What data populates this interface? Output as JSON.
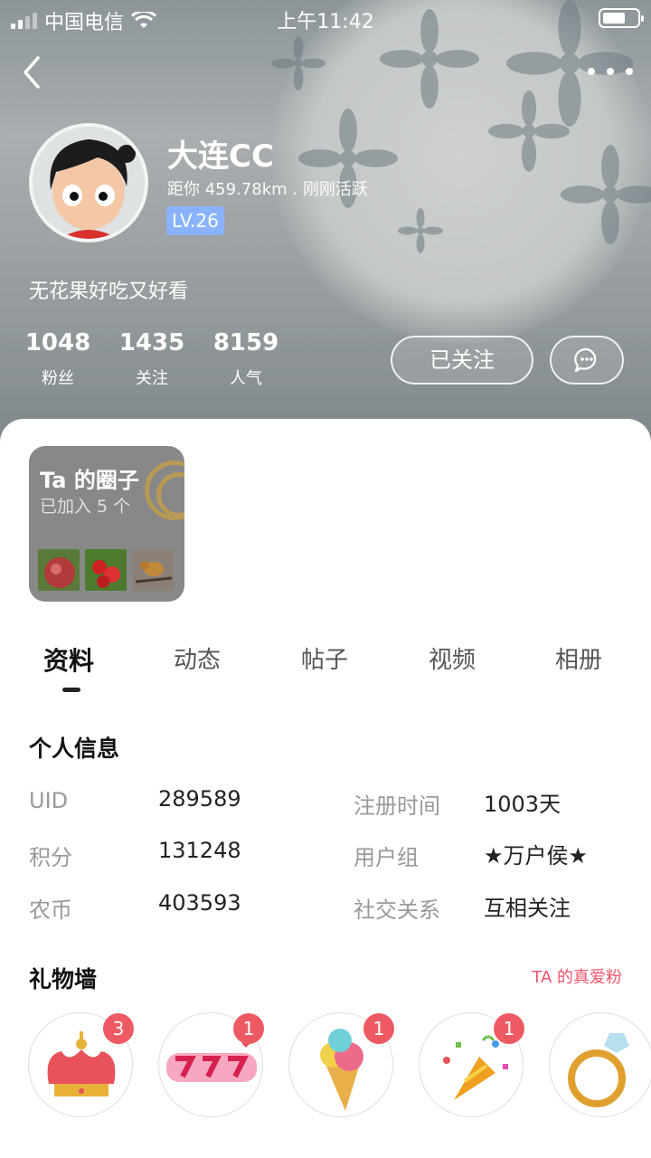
{
  "status_bar": {
    "carrier": "中国电信",
    "time": "上午11:42"
  },
  "profile": {
    "nickname": "大连CC",
    "distance_text": "距你 459.78km . 刚刚活跃",
    "level": "LV.26",
    "bio": "无花果好吃又好看"
  },
  "stats": [
    {
      "value": "1048",
      "label": "粉丝"
    },
    {
      "value": "1435",
      "label": "关注"
    },
    {
      "value": "8159",
      "label": "人气"
    }
  ],
  "actions": {
    "follow_label": "已关注"
  },
  "circles": {
    "title": "Ta 的圈子",
    "subtitle": "已加入 5 个"
  },
  "tabs": [
    "资料",
    "动态",
    "帖子",
    "视频",
    "相册"
  ],
  "active_tab": "资料",
  "personal_info": {
    "title": "个人信息",
    "rows": [
      {
        "label": "UID",
        "value": "289589"
      },
      {
        "label": "注册时间",
        "value": "1003天"
      },
      {
        "label": "积分",
        "value": "131248"
      },
      {
        "label": "用户组",
        "value": "★万户侯★"
      },
      {
        "label": "农币",
        "value": "403593"
      },
      {
        "label": "社交关系",
        "value": "互相关注"
      }
    ]
  },
  "gift_wall": {
    "title": "礼物墙",
    "link": "TA 的真爱粉",
    "gifts": [
      {
        "icon": "crown-icon",
        "count": "3"
      },
      {
        "icon": "kiss-sticker-icon",
        "count": "1"
      },
      {
        "icon": "ice-cream-icon",
        "count": "1"
      },
      {
        "icon": "party-popper-icon",
        "count": "1"
      },
      {
        "icon": "ring-icon",
        "count": ""
      }
    ]
  }
}
